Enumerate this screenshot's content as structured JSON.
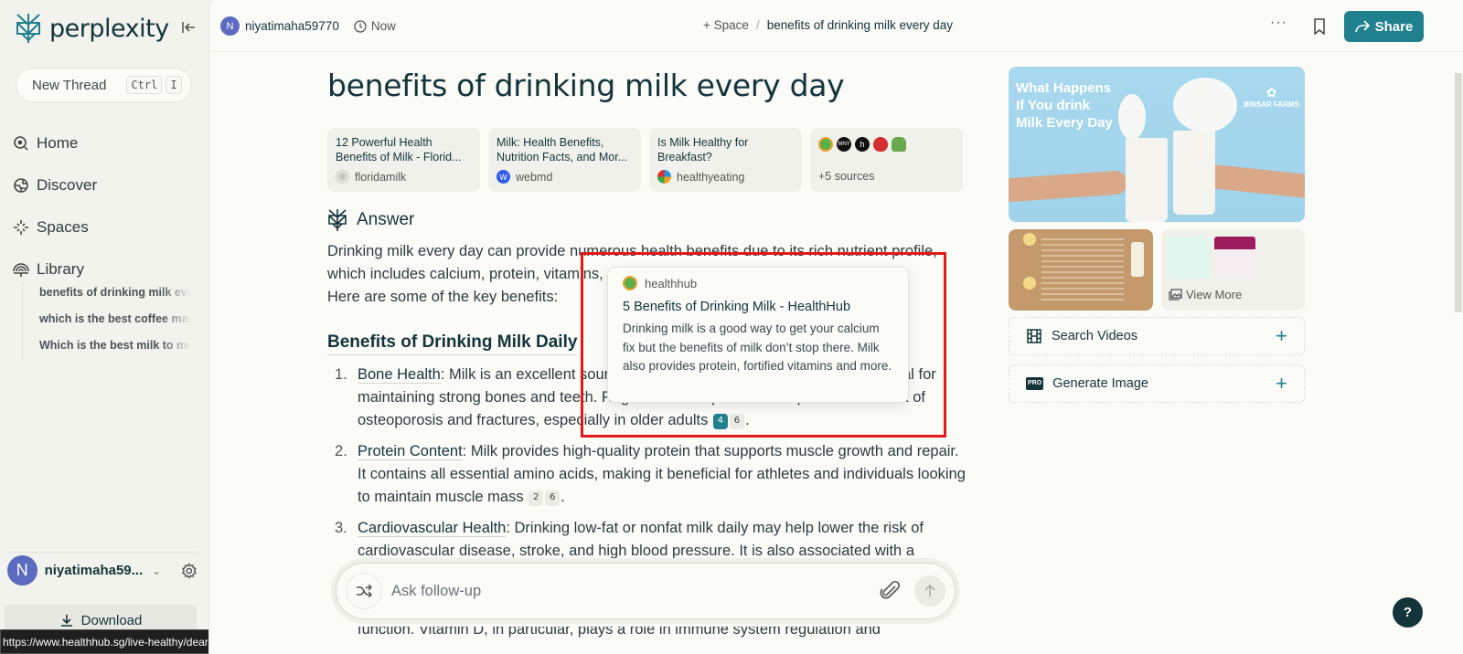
{
  "app": {
    "brand": "perplexity",
    "brand_color": "#20808d",
    "accent_dark": "#13343b"
  },
  "sidebar": {
    "new_thread": {
      "label": "New Thread",
      "shortcut_keys": [
        "Ctrl",
        "I"
      ]
    },
    "nav": [
      {
        "label": "Home",
        "icon": "home-search-icon"
      },
      {
        "label": "Discover",
        "icon": "globe-icon"
      },
      {
        "label": "Spaces",
        "icon": "sparkle-icon"
      },
      {
        "label": "Library",
        "icon": "library-icon"
      }
    ],
    "library_items": [
      "benefits of drinking milk every day",
      "which is the best coffee machine",
      "Which is the best milk to make"
    ],
    "user": {
      "initial": "N",
      "name": "niyatimaha59..."
    },
    "download_label": "Download",
    "status_url": "https://www.healthhub.sg/live-healthy/dear-dairy"
  },
  "topbar": {
    "user_initial": "N",
    "username": "niyatimaha59770",
    "time": "Now",
    "breadcrumb": {
      "space": "+ Space",
      "separator": "/",
      "current": "benefits of drinking milk every day"
    },
    "more_label": "···",
    "share_label": "Share"
  },
  "thread": {
    "title": "benefits of drinking milk every day",
    "sources": [
      {
        "title": "12 Powerful Health Benefits of Milk - Florid...",
        "site": "floridamilk",
        "favicon": "globe-icon"
      },
      {
        "title": "Milk: Health Benefits, Nutrition Facts, and Mor...",
        "site": "webmd",
        "favicon": "webmd-icon"
      },
      {
        "title": "Is Milk Healthy for Breakfast?",
        "site": "healthyeating",
        "favicon": "healthyeating-icon"
      }
    ],
    "more_sources": {
      "label": "+5 sources",
      "favicons": [
        "healthhub-icon",
        "mny-icon",
        "h-icon",
        "apple-icon",
        "leaf-icon"
      ]
    },
    "answer_label": "Answer",
    "intro_parts": [
      "Drinking milk every day can provide numerous health benefits due to its rich nutrient profile, which includes calcium, protein, vitamins, and minerals.",
      "Here are some of the key benefits:"
    ],
    "section_heading": "Benefits of Drinking Milk Daily",
    "benefits": [
      {
        "num": "1.",
        "title": "Bone Health",
        "text": ": Milk is an excellent source of calcium and vitamin D, which are crucial for maintaining strong bones and teeth. Regular consumption can help reduce the risk of osteoporosis and fractures, especially in older adults",
        "citations": [
          {
            "n": "4",
            "active": true
          },
          {
            "n": "6",
            "active": false
          }
        ]
      },
      {
        "num": "2.",
        "title": "Protein Content",
        "text": ": Milk provides high-quality protein that supports muscle growth and repair. It contains all essential amino acids, making it beneficial for athletes and individuals looking to maintain muscle mass",
        "citations": [
          {
            "n": "2",
            "active": false
          },
          {
            "n": "6",
            "active": false
          }
        ]
      },
      {
        "num": "3.",
        "title": "Cardiovascular Health",
        "text": ": Drinking low-fat or nonfat milk daily may help lower the risk of cardiovascular disease, stroke, and high blood pressure. It is also associated with a",
        "citations": []
      }
    ],
    "trailing_line": "function. Vitamin D, in particular, plays a role in immune system regulation and"
  },
  "tooltip": {
    "site": "healthhub",
    "title": "5 Benefits of Drinking Milk - HealthHub",
    "snippet": "Drinking milk is a good way to get your calcium fix but the benefits of milk don’t stop there. Milk also provides protein, fortified vitamins and more.",
    "highlight_color": "#e11919"
  },
  "followup": {
    "placeholder": "Ask follow-up"
  },
  "media": {
    "hero_caption": "What Happens If You drink Milk Every Day",
    "hero_brand": "BINSAR FARMS",
    "view_more_label": "View More",
    "actions": [
      {
        "label": "Search Videos",
        "icon": "film-icon"
      },
      {
        "label": "Generate Image",
        "icon": "pro-badge-icon",
        "badge": "PRO"
      }
    ]
  },
  "help_label": "?"
}
